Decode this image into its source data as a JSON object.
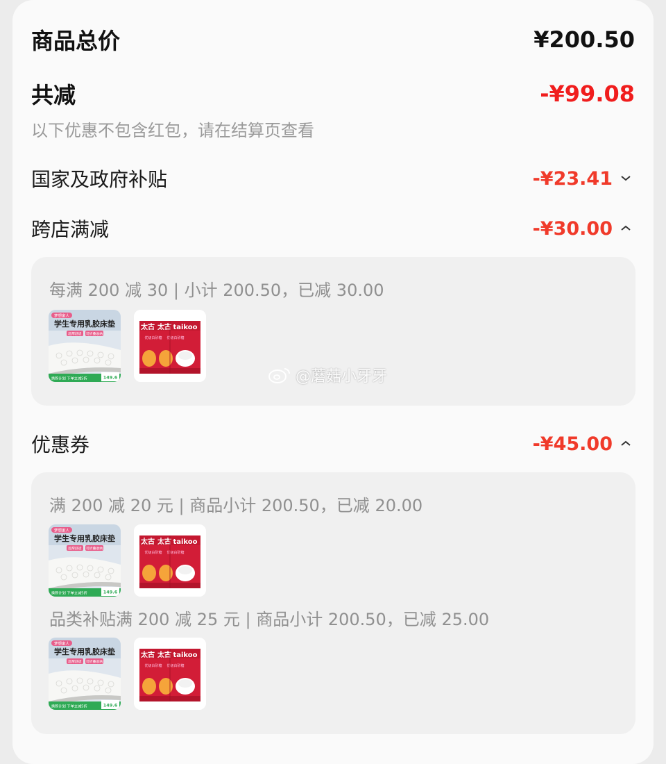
{
  "summary": {
    "total_label": "商品总价",
    "total_value": "¥200.50",
    "reduce_label": "共减",
    "reduce_value": "-¥99.08",
    "note": "以下优惠不包含红包，请在结算页查看"
  },
  "discounts": [
    {
      "label": "国家及政府补贴",
      "value": "-¥23.41",
      "chevron": "chevron-down-icon"
    },
    {
      "label": "跨店满减",
      "value": "-¥30.00",
      "chevron": "chevron-up-icon"
    },
    {
      "label": "优惠券",
      "value": "-¥45.00",
      "chevron": "chevron-up-icon"
    }
  ],
  "cross_store": {
    "rule": "每满 200 减 30 | 小计 200.50，已减 30.00"
  },
  "coupons": [
    {
      "rule": "满 200 减 20 元 | 商品小计 200.50，已减 20.00"
    },
    {
      "rule": "品类补贴满 200 减 25 元 | 商品小计 200.50，已减 25.00"
    }
  ],
  "products": {
    "mattress": {
      "badge": "梦想家人",
      "title": "学生专用乳胶床垫",
      "tags": [
        "超厚舒适",
        "可折叠收纳"
      ],
      "footer": "换新计划  下单立减5折",
      "price": "149.6"
    },
    "sugar": {
      "brand": "太古",
      "brand_en": "taikoo",
      "sub": "优级白砂糖"
    }
  },
  "watermark": "@蘑菇小牙牙",
  "colors": {
    "accent_red": "#f01d1d",
    "soft_red": "#f03a2a",
    "muted": "#9a9a9a"
  }
}
